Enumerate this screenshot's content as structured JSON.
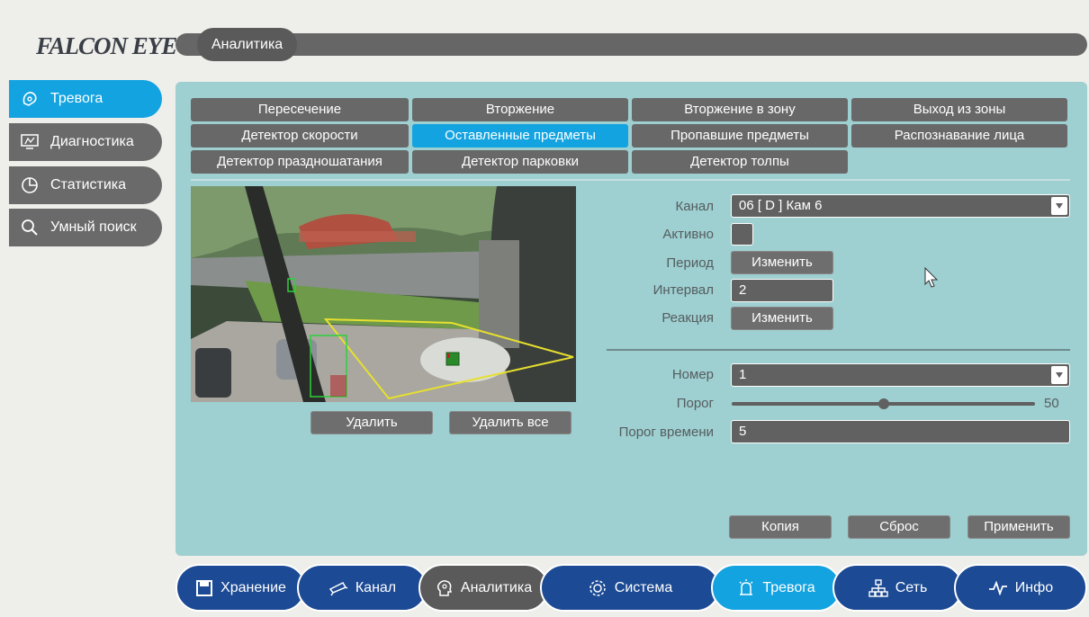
{
  "brand": {
    "logo": "FALCON EYE"
  },
  "header": {
    "title": "Аналитика"
  },
  "sidebar": {
    "items": [
      {
        "label": "Тревога",
        "icon": "alarm-icon",
        "active": true
      },
      {
        "label": "Диагностика",
        "icon": "diagnostics-icon",
        "active": false
      },
      {
        "label": "Статистика",
        "icon": "pie-chart-icon",
        "active": false
      },
      {
        "label": "Умный поиск",
        "icon": "search-icon",
        "active": false
      }
    ]
  },
  "tabs": [
    {
      "label": "Пересечение",
      "active": false
    },
    {
      "label": "Вторжение",
      "active": false
    },
    {
      "label": "Вторжение в зону",
      "active": false
    },
    {
      "label": "Выход из зоны",
      "active": false
    },
    {
      "label": "Детектор скорости",
      "active": false
    },
    {
      "label": "Оставленные предметы",
      "active": true
    },
    {
      "label": "Пропавшие предметы",
      "active": false
    },
    {
      "label": "Распознавание лица",
      "active": false
    },
    {
      "label": "Детектор праздношатания",
      "active": false
    },
    {
      "label": "Детектор парковки",
      "active": false
    },
    {
      "label": "Детектор толпы",
      "active": false
    }
  ],
  "video": {
    "delete_label": "Удалить",
    "delete_all_label": "Удалить все"
  },
  "form": {
    "channel_label": "Канал",
    "channel_value": "06 [ D ] Кам 6",
    "active_label": "Активно",
    "active_checked": false,
    "period_label": "Период",
    "period_button": "Изменить",
    "interval_label": "Интервал",
    "interval_value": "2",
    "reaction_label": "Реакция",
    "reaction_button": "Изменить",
    "number_label": "Номер",
    "number_value": "1",
    "threshold_label": "Порог",
    "threshold_value": "50",
    "threshold_fraction": 0.5,
    "time_threshold_label": "Порог времени",
    "time_threshold_value": "5"
  },
  "actions": {
    "copy_label": "Копия",
    "reset_label": "Сброс",
    "apply_label": "Применить"
  },
  "bottom_nav": [
    {
      "label": "Хранение",
      "icon": "storage-icon",
      "color": "#1c4a94"
    },
    {
      "label": "Канал",
      "icon": "camera-icon",
      "color": "#1c4a94"
    },
    {
      "label": "Аналитика",
      "icon": "head-icon",
      "color": "#5a5a5a"
    },
    {
      "label": "Система",
      "icon": "gear-icon",
      "color": "#1c4a94"
    },
    {
      "label": "Тревога",
      "icon": "alarm-icon",
      "color": "#13a3e0"
    },
    {
      "label": "Сеть",
      "icon": "network-icon",
      "color": "#1c4a94"
    },
    {
      "label": "Инфо",
      "icon": "pulse-icon",
      "color": "#1c4a94"
    }
  ],
  "colors": {
    "accent": "#13a3e0",
    "panel": "#9ecfd1",
    "nav": "#1c4a94",
    "control": "#616161"
  }
}
